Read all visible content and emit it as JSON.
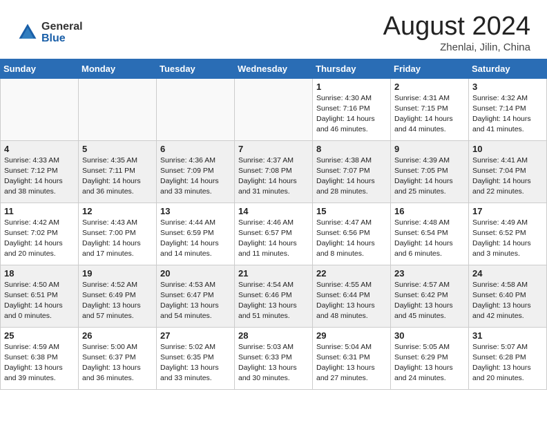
{
  "header": {
    "logo_general": "General",
    "logo_blue": "Blue",
    "month_title": "August 2024",
    "location": "Zhenlai, Jilin, China"
  },
  "weekdays": [
    "Sunday",
    "Monday",
    "Tuesday",
    "Wednesday",
    "Thursday",
    "Friday",
    "Saturday"
  ],
  "weeks": [
    [
      {
        "day": "",
        "info": ""
      },
      {
        "day": "",
        "info": ""
      },
      {
        "day": "",
        "info": ""
      },
      {
        "day": "",
        "info": ""
      },
      {
        "day": "1",
        "info": "Sunrise: 4:30 AM\nSunset: 7:16 PM\nDaylight: 14 hours\nand 46 minutes."
      },
      {
        "day": "2",
        "info": "Sunrise: 4:31 AM\nSunset: 7:15 PM\nDaylight: 14 hours\nand 44 minutes."
      },
      {
        "day": "3",
        "info": "Sunrise: 4:32 AM\nSunset: 7:14 PM\nDaylight: 14 hours\nand 41 minutes."
      }
    ],
    [
      {
        "day": "4",
        "info": "Sunrise: 4:33 AM\nSunset: 7:12 PM\nDaylight: 14 hours\nand 38 minutes."
      },
      {
        "day": "5",
        "info": "Sunrise: 4:35 AM\nSunset: 7:11 PM\nDaylight: 14 hours\nand 36 minutes."
      },
      {
        "day": "6",
        "info": "Sunrise: 4:36 AM\nSunset: 7:09 PM\nDaylight: 14 hours\nand 33 minutes."
      },
      {
        "day": "7",
        "info": "Sunrise: 4:37 AM\nSunset: 7:08 PM\nDaylight: 14 hours\nand 31 minutes."
      },
      {
        "day": "8",
        "info": "Sunrise: 4:38 AM\nSunset: 7:07 PM\nDaylight: 14 hours\nand 28 minutes."
      },
      {
        "day": "9",
        "info": "Sunrise: 4:39 AM\nSunset: 7:05 PM\nDaylight: 14 hours\nand 25 minutes."
      },
      {
        "day": "10",
        "info": "Sunrise: 4:41 AM\nSunset: 7:04 PM\nDaylight: 14 hours\nand 22 minutes."
      }
    ],
    [
      {
        "day": "11",
        "info": "Sunrise: 4:42 AM\nSunset: 7:02 PM\nDaylight: 14 hours\nand 20 minutes."
      },
      {
        "day": "12",
        "info": "Sunrise: 4:43 AM\nSunset: 7:00 PM\nDaylight: 14 hours\nand 17 minutes."
      },
      {
        "day": "13",
        "info": "Sunrise: 4:44 AM\nSunset: 6:59 PM\nDaylight: 14 hours\nand 14 minutes."
      },
      {
        "day": "14",
        "info": "Sunrise: 4:46 AM\nSunset: 6:57 PM\nDaylight: 14 hours\nand 11 minutes."
      },
      {
        "day": "15",
        "info": "Sunrise: 4:47 AM\nSunset: 6:56 PM\nDaylight: 14 hours\nand 8 minutes."
      },
      {
        "day": "16",
        "info": "Sunrise: 4:48 AM\nSunset: 6:54 PM\nDaylight: 14 hours\nand 6 minutes."
      },
      {
        "day": "17",
        "info": "Sunrise: 4:49 AM\nSunset: 6:52 PM\nDaylight: 14 hours\nand 3 minutes."
      }
    ],
    [
      {
        "day": "18",
        "info": "Sunrise: 4:50 AM\nSunset: 6:51 PM\nDaylight: 14 hours\nand 0 minutes."
      },
      {
        "day": "19",
        "info": "Sunrise: 4:52 AM\nSunset: 6:49 PM\nDaylight: 13 hours\nand 57 minutes."
      },
      {
        "day": "20",
        "info": "Sunrise: 4:53 AM\nSunset: 6:47 PM\nDaylight: 13 hours\nand 54 minutes."
      },
      {
        "day": "21",
        "info": "Sunrise: 4:54 AM\nSunset: 6:46 PM\nDaylight: 13 hours\nand 51 minutes."
      },
      {
        "day": "22",
        "info": "Sunrise: 4:55 AM\nSunset: 6:44 PM\nDaylight: 13 hours\nand 48 minutes."
      },
      {
        "day": "23",
        "info": "Sunrise: 4:57 AM\nSunset: 6:42 PM\nDaylight: 13 hours\nand 45 minutes."
      },
      {
        "day": "24",
        "info": "Sunrise: 4:58 AM\nSunset: 6:40 PM\nDaylight: 13 hours\nand 42 minutes."
      }
    ],
    [
      {
        "day": "25",
        "info": "Sunrise: 4:59 AM\nSunset: 6:38 PM\nDaylight: 13 hours\nand 39 minutes."
      },
      {
        "day": "26",
        "info": "Sunrise: 5:00 AM\nSunset: 6:37 PM\nDaylight: 13 hours\nand 36 minutes."
      },
      {
        "day": "27",
        "info": "Sunrise: 5:02 AM\nSunset: 6:35 PM\nDaylight: 13 hours\nand 33 minutes."
      },
      {
        "day": "28",
        "info": "Sunrise: 5:03 AM\nSunset: 6:33 PM\nDaylight: 13 hours\nand 30 minutes."
      },
      {
        "day": "29",
        "info": "Sunrise: 5:04 AM\nSunset: 6:31 PM\nDaylight: 13 hours\nand 27 minutes."
      },
      {
        "day": "30",
        "info": "Sunrise: 5:05 AM\nSunset: 6:29 PM\nDaylight: 13 hours\nand 24 minutes."
      },
      {
        "day": "31",
        "info": "Sunrise: 5:07 AM\nSunset: 6:28 PM\nDaylight: 13 hours\nand 20 minutes."
      }
    ]
  ]
}
